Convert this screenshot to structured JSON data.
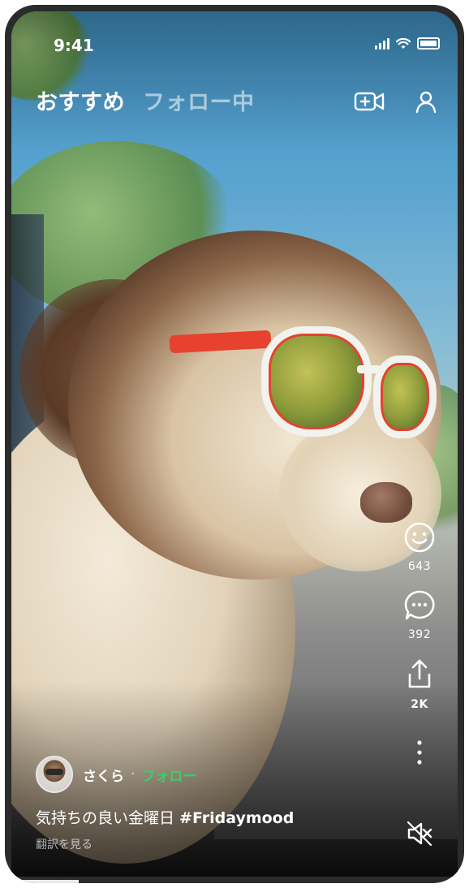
{
  "status_bar": {
    "time": "9:41"
  },
  "feed_tabs": [
    {
      "label": "おすすめ",
      "active": true
    },
    {
      "label": "フォロー中",
      "active": false
    }
  ],
  "top_actions": {
    "icons": [
      "live-camera-icon",
      "profile-icon"
    ]
  },
  "actions": {
    "like_count": "643",
    "comment_count": "392",
    "share_count": "2K"
  },
  "post": {
    "author": "さくら",
    "separator": "·",
    "follow_label": "フォロー",
    "description": "気持ちの良い金曜日 ",
    "hashtag": "#Fridaymood",
    "translate_label": "翻訳を見る"
  },
  "colors": {
    "follow_accent": "#35d16a",
    "text": "#ffffff",
    "glasses_frame": "#e6422e"
  },
  "playback": {
    "progress": 0.15
  }
}
